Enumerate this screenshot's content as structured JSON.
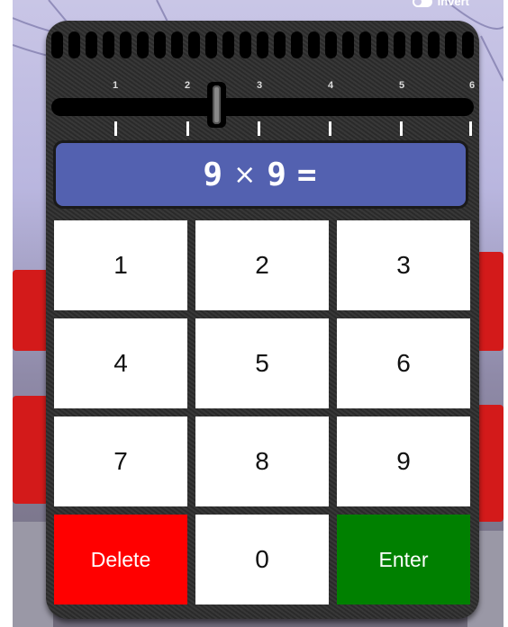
{
  "header": {
    "invert_label": "Invert"
  },
  "slider": {
    "tick_labels": [
      "1",
      "2",
      "3",
      "4",
      "5",
      "6"
    ],
    "selected_value": 2.4
  },
  "display": {
    "operand_a": "9",
    "operator": "×",
    "operand_b": "9",
    "equals": "="
  },
  "keypad": {
    "keys": [
      "1",
      "2",
      "3",
      "4",
      "5",
      "6",
      "7",
      "8",
      "9"
    ],
    "delete_label": "Delete",
    "zero_label": "0",
    "enter_label": "Enter"
  },
  "colors": {
    "display_bg": "#5361b0",
    "delete_bg": "#ff0000",
    "enter_bg": "#008000",
    "panel_bg": "#2d2d2d"
  }
}
